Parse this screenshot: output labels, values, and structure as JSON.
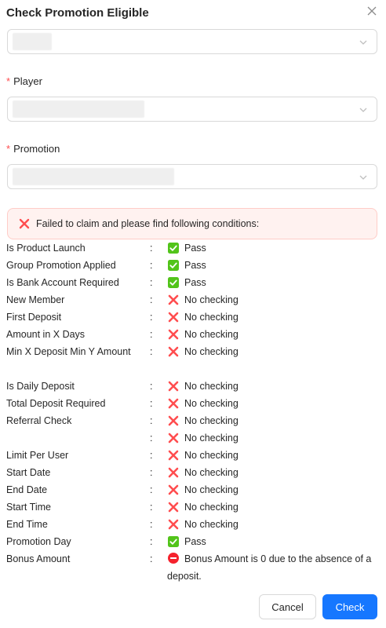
{
  "modal": {
    "title": "Check Promotion Eligible",
    "close_icon": "close-icon"
  },
  "form": {
    "player_label": "Player",
    "promotion_label": "Promotion",
    "required_mark": "*"
  },
  "alert": {
    "icon": "x-icon",
    "text": "Failed to claim and please find following conditions:"
  },
  "conditions": [
    {
      "name": "Is Product Launch",
      "status": "pass",
      "value": "Pass"
    },
    {
      "name": "Group Promotion Applied",
      "status": "pass",
      "value": "Pass"
    },
    {
      "name": "Is Bank Account Required",
      "status": "pass",
      "value": "Pass"
    },
    {
      "name": "New Member",
      "status": "fail",
      "value": "No checking"
    },
    {
      "name": "First Deposit",
      "status": "fail",
      "value": "No checking"
    },
    {
      "name": "Amount in X Days",
      "status": "fail",
      "value": "No checking"
    },
    {
      "name": "Min X Deposit Min Y Amount",
      "status": "fail",
      "value": "No checking",
      "tall": true
    },
    {
      "name": "Is Daily Deposit",
      "status": "fail",
      "value": "No checking"
    },
    {
      "name": "Total Deposit Required",
      "status": "fail",
      "value": "No checking"
    },
    {
      "name": "Referral Check",
      "status": "fail",
      "value": "No checking"
    },
    {
      "name": "",
      "status": "fail",
      "value": "No checking"
    },
    {
      "name": "Limit Per User",
      "status": "fail",
      "value": "No checking"
    },
    {
      "name": "Start Date",
      "status": "fail",
      "value": "No checking"
    },
    {
      "name": "End Date",
      "status": "fail",
      "value": "No checking"
    },
    {
      "name": "Start Time",
      "status": "fail",
      "value": "No checking"
    },
    {
      "name": "End Time",
      "status": "fail",
      "value": "No checking"
    },
    {
      "name": "Promotion Day",
      "status": "pass",
      "value": "Pass"
    },
    {
      "name": "Bonus Amount",
      "status": "blocked",
      "value": "Bonus Amount is 0 due to the absence of a deposit.",
      "wrap": true
    }
  ],
  "colon": ":",
  "footer": {
    "cancel_label": "Cancel",
    "check_label": "Check"
  },
  "colors": {
    "primary": "#1677ff",
    "pass": "#52c41a",
    "fail": "#ff4d4f",
    "alert_bg": "#fff2f0"
  }
}
